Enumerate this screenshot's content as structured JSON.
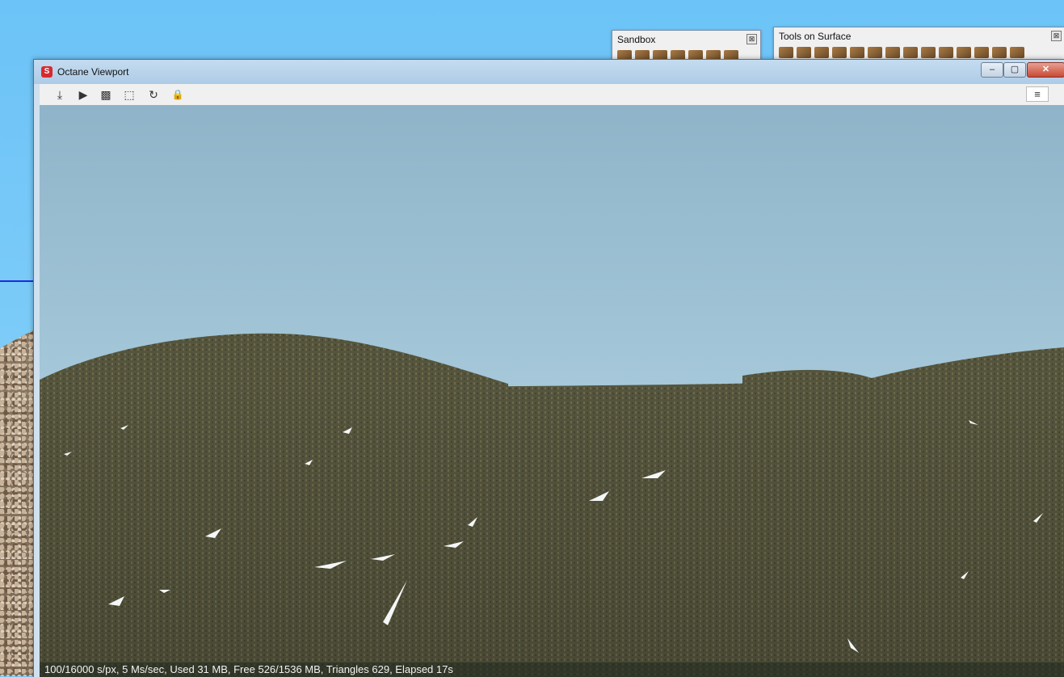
{
  "palettes": {
    "sandbox": {
      "title": "Sandbox",
      "close": "⊠"
    },
    "tools_on_surface": {
      "title": "Tools on Surface",
      "close": "⊠"
    }
  },
  "window": {
    "title": "Octane Viewport",
    "app_icon": "sketchup-icon",
    "controls": {
      "minimize": "–",
      "maximize": "▢",
      "close": "✕"
    }
  },
  "toolbar": {
    "buttons": [
      {
        "name": "download-icon",
        "glyph": "⤓"
      },
      {
        "name": "play-icon",
        "glyph": "▶"
      },
      {
        "name": "checker-icon",
        "glyph": "▩"
      },
      {
        "name": "region-select-icon",
        "glyph": "⬚"
      },
      {
        "name": "refresh-icon",
        "glyph": "↻"
      },
      {
        "name": "lock-icon",
        "glyph": "🔒"
      }
    ],
    "menu_glyph": "≡"
  },
  "status": {
    "text": "100/16000 s/px, 5 Ms/sec, Used 31 MB, Free 526/1536 MB, Triangles 629, Elapsed 17s"
  },
  "colors": {
    "sky_top": "#8fb4c9",
    "sky_horizon": "#c9e0ec",
    "grass": "#57573f",
    "grass_light": "#6b6848",
    "snow": "#f4f6f7"
  }
}
